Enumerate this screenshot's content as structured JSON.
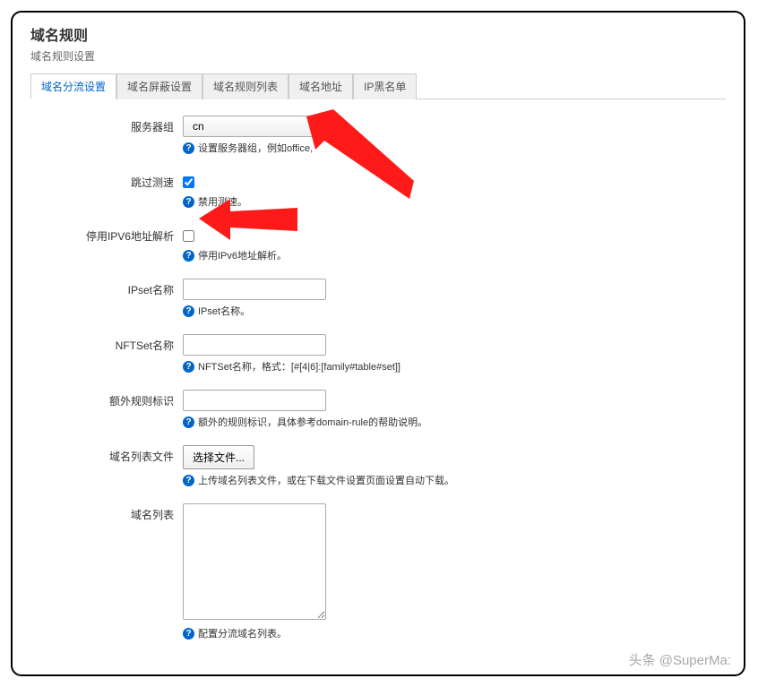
{
  "header": {
    "title": "域名规则",
    "subtitle": "域名规则设置"
  },
  "tabs": [
    {
      "label": "域名分流设置",
      "active": true
    },
    {
      "label": "域名屏蔽设置",
      "active": false
    },
    {
      "label": "域名规则列表",
      "active": false
    },
    {
      "label": "域名地址",
      "active": false
    },
    {
      "label": "IP黑名单",
      "active": false
    }
  ],
  "form": {
    "server_group": {
      "label": "服务器组",
      "value": "cn",
      "help": "设置服务器组，例如office,"
    },
    "skip_speed": {
      "label": "跳过测速",
      "checked": true,
      "help": "禁用测速。"
    },
    "disable_ipv6": {
      "label": "停用IPV6地址解析",
      "checked": false,
      "help": "停用IPv6地址解析。"
    },
    "ipset_name": {
      "label": "IPset名称",
      "value": "",
      "help": "IPset名称。"
    },
    "nftset_name": {
      "label": "NFTSet名称",
      "value": "",
      "help": "NFTSet名称，格式：[#[4|6]:[family#table#set]]"
    },
    "extra_rule": {
      "label": "额外规则标识",
      "value": "",
      "help": "额外的规则标识，具体参考domain-rule的帮助说明。"
    },
    "domain_file": {
      "label": "域名列表文件",
      "button": "选择文件...",
      "help": "上传域名列表文件，或在下载文件设置页面设置自动下载。"
    },
    "domain_list": {
      "label": "域名列表",
      "value": "",
      "help": "配置分流域名列表。"
    }
  },
  "watermark": "头条 @SuperMa:"
}
